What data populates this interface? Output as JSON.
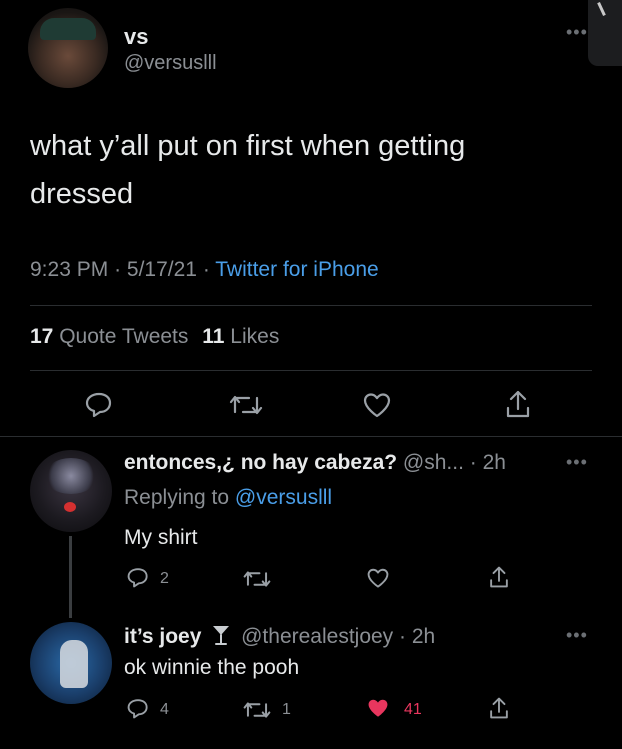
{
  "tweet": {
    "author_name": "vs",
    "author_handle": "@versuslll",
    "text_line1": "what y’all put on first when getting",
    "text_line2": "dressed",
    "time": "9:23 PM",
    "date": "5/17/21",
    "source": "Twitter for iPhone",
    "quote_count": "17",
    "quote_label": "Quote Tweets",
    "like_count": "11",
    "like_label": "Likes",
    "more_icon": "more-horizontal-icon"
  },
  "replies": [
    {
      "author_name": "entonces,¿ no hay cabeza?",
      "author_handle": "@sh...",
      "time": "2h",
      "replying_label": "Replying to",
      "replying_to": "@versuslll",
      "text": "My shirt",
      "reply_count": "2",
      "retweet_count": "",
      "like_count": ""
    },
    {
      "author_name": "it’s joey",
      "badge_icon": "martini-glass-icon",
      "author_handle": "@therealestjoey",
      "time": "2h",
      "text": "ok winnie the pooh",
      "reply_count": "4",
      "retweet_count": "1",
      "like_count": "41",
      "liked": true
    }
  ],
  "colors": {
    "background": "#000000",
    "text": "#e7e9ea",
    "muted": "#8b8f94",
    "link": "#4a9ee8",
    "like_active": "#f91880"
  }
}
